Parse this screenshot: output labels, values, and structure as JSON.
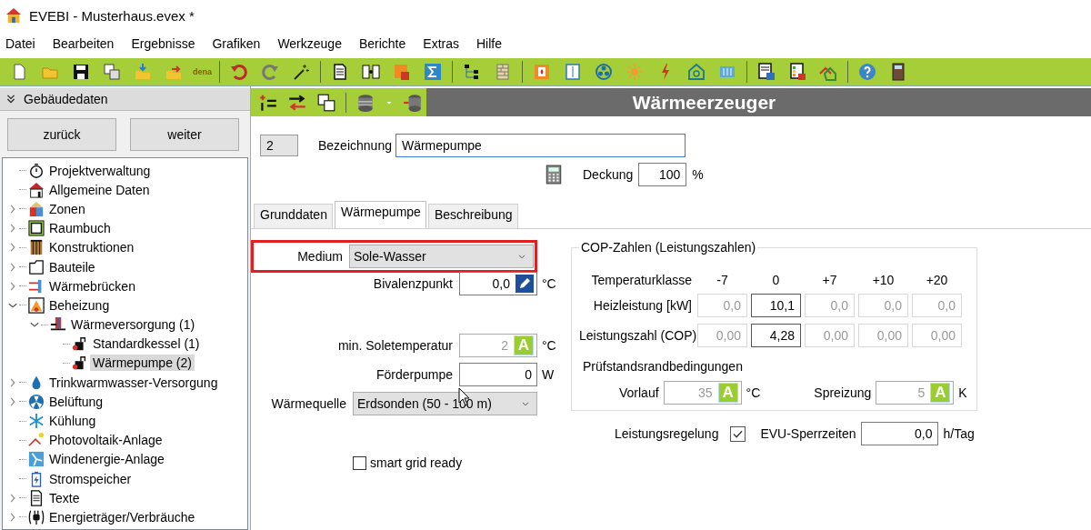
{
  "window": {
    "title": "EVEBI - Musterhaus.evex *"
  },
  "menu": [
    "Datei",
    "Bearbeiten",
    "Ergebnisse",
    "Grafiken",
    "Werkzeuge",
    "Berichte",
    "Extras",
    "Hilfe"
  ],
  "toolbar": {
    "dena_label": "dena"
  },
  "sidebar": {
    "title": "Gebäudedaten",
    "buttons": [
      "zurück",
      "weiter"
    ],
    "tree": [
      {
        "label": "Projektverwaltung",
        "kind": "leaf",
        "selected": false
      },
      {
        "label": "Allgemeine Daten",
        "kind": "leaf",
        "selected": false
      },
      {
        "label": "Zonen",
        "kind": "branch",
        "expanded": false,
        "selected": false
      },
      {
        "label": "Raumbuch",
        "kind": "branch",
        "expanded": false,
        "selected": false
      },
      {
        "label": "Konstruktionen",
        "kind": "branch",
        "expanded": false,
        "selected": false
      },
      {
        "label": "Bauteile",
        "kind": "branch",
        "expanded": false,
        "selected": false
      },
      {
        "label": "Wärmebrücken",
        "kind": "branch",
        "expanded": false,
        "selected": false
      },
      {
        "label": "Beheizung",
        "kind": "branch",
        "expanded": true,
        "selected": false,
        "children": [
          {
            "label": "Wärmeversorgung (1)",
            "kind": "branch",
            "expanded": true,
            "selected": false,
            "children": [
              {
                "label": "Standardkessel (1)",
                "kind": "leaf",
                "selected": false
              },
              {
                "label": "Wärmepumpe (2)",
                "kind": "leaf",
                "selected": true
              }
            ]
          }
        ]
      },
      {
        "label": "Trinkwarmwasser-Versorgung",
        "kind": "branch",
        "expanded": false,
        "selected": false
      },
      {
        "label": "Belüftung",
        "kind": "branch",
        "expanded": false,
        "selected": false
      },
      {
        "label": "Kühlung",
        "kind": "leaf",
        "selected": false
      },
      {
        "label": "Photovoltaik-Anlage",
        "kind": "leaf",
        "selected": false
      },
      {
        "label": "Windenergie-Anlage",
        "kind": "leaf",
        "selected": false
      },
      {
        "label": "Stromspeicher",
        "kind": "leaf",
        "selected": false
      },
      {
        "label": "Texte",
        "kind": "branch",
        "expanded": false,
        "selected": false
      },
      {
        "label": "Energieträger/Verbräuche",
        "kind": "branch",
        "expanded": false,
        "selected": false
      }
    ]
  },
  "editor": {
    "heading": "Wärmeerzeuger",
    "number": "2",
    "name_label": "Bezeichnung",
    "name_value": "Wärmepumpe",
    "coverage_label": "Deckung",
    "coverage_value": "100",
    "coverage_unit": "%",
    "tabs": [
      {
        "label": "Grunddaten",
        "selected": false
      },
      {
        "label": "Wärmepumpe",
        "selected": true
      },
      {
        "label": "Beschreibung",
        "selected": false
      }
    ],
    "fields": [
      {
        "kind": "select",
        "label": "Medium",
        "value": "Sole-Wasser",
        "highlighted": true
      },
      {
        "kind": "edit",
        "label": "Bivalenzpunkt",
        "value": "0,0",
        "unit": "°C",
        "disabled": false
      },
      {
        "kind": "auto",
        "label": "min. Soletemperatur",
        "value": "2",
        "badge": "A",
        "unit": "°C",
        "disabled": true
      },
      {
        "kind": "input",
        "label": "Förderpumpe",
        "value": "0",
        "unit": "W",
        "disabled": false
      },
      {
        "kind": "select",
        "label": "Wärmequelle",
        "value": "Erdsonden (50 - 100 m)",
        "highlighted": false
      }
    ],
    "smart_grid": {
      "label": "smart grid ready",
      "checked": false
    },
    "cop": {
      "title": "COP-Zahlen (Leistungszahlen)",
      "header_label": "Temperaturklasse",
      "columns": [
        "-7",
        "0",
        "+7",
        "+10",
        "+20"
      ],
      "rows": [
        {
          "label": "Heizleistung [kW]",
          "cells": [
            {
              "value": "0,0",
              "disabled": true
            },
            {
              "value": "10,1",
              "disabled": false
            },
            {
              "value": "0,0",
              "disabled": true
            },
            {
              "value": "0,0",
              "disabled": true
            },
            {
              "value": "0,0",
              "disabled": true
            }
          ]
        },
        {
          "label": "Leistungszahl (COP)",
          "cells": [
            {
              "value": "0,00",
              "disabled": true
            },
            {
              "value": "4,28",
              "disabled": false
            },
            {
              "value": "0,00",
              "disabled": true
            },
            {
              "value": "0,00",
              "disabled": true
            },
            {
              "value": "0,00",
              "disabled": true
            }
          ]
        }
      ],
      "conditions_title": "Prüfstandsrandbedingungen",
      "conditions": [
        {
          "label": "Vorlauf",
          "value": "35",
          "badge": "A",
          "unit": "°C",
          "disabled": true
        },
        {
          "label": "Spreizung",
          "value": "5",
          "badge": "A",
          "unit": "K",
          "disabled": true
        }
      ]
    },
    "power_control": {
      "label": "Leistungsregelung",
      "checked": true
    },
    "lockout": {
      "label": "EVU-Sperrzeiten",
      "value": "0,0",
      "unit": "h/Tag"
    }
  }
}
